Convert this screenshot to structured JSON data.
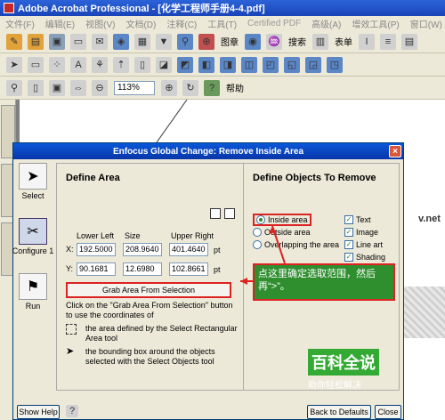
{
  "app": {
    "title": "Adobe Acrobat Professional - [化学工程师手册4-4.pdf]",
    "menu": [
      "文件(F)",
      "编辑(E)",
      "视图(V)",
      "文档(D)",
      "注释(C)",
      "工具(T)",
      "Certified PDF",
      "高级(A)",
      "增效工具(P)",
      "窗口(W)"
    ],
    "toolbar": {
      "stamp": "图章",
      "search": "搜索",
      "form": "表单",
      "help": "帮助",
      "zoom": "113%"
    }
  },
  "page_fragment": "v.net",
  "dialog": {
    "title": "Enfocus Global Change: Remove Inside Area",
    "side": {
      "select": "Select",
      "configure": "Configure 1",
      "run": "Run"
    },
    "define_area": {
      "heading": "Define Area",
      "col_lower_left": "Lower Left",
      "col_size": "Size",
      "col_upper_right": "Upper Right",
      "x_label": "X:",
      "y_label": "Y:",
      "x_lower_left": "192.5000",
      "x_size": "208.9640",
      "x_upper_right": "401.4640",
      "y_lower_left": "90.1681",
      "y_size": "12.6980",
      "y_upper_right": "102.8661",
      "unit": "pt",
      "grab_button": "Grab Area From Selection",
      "help_text": "Click on the \"Grab Area From Selection\" button to use the coordinates of",
      "option1": "the area defined by the Select Rectangular Area tool",
      "option2": "the bounding box around the objects selected with the Select Objects tool"
    },
    "define_objects": {
      "heading": "Define Objects To Remove",
      "radios": [
        {
          "label": "Inside area",
          "selected": true
        },
        {
          "label": "Outside area",
          "selected": false
        },
        {
          "label": "Overlapping the area",
          "selected": false
        }
      ],
      "checks": [
        {
          "label": "Text",
          "checked": true
        },
        {
          "label": "Image",
          "checked": true
        },
        {
          "label": "Line art",
          "checked": true
        },
        {
          "label": "Shading",
          "checked": true
        }
      ]
    },
    "buttons": {
      "show_help": "Show Help",
      "back_to_defaults": "Back to Defaults",
      "close": "Close"
    }
  },
  "annotation": {
    "callout": "点这里确定选取范围，然后再“>”。"
  },
  "watermark": {
    "main": "百科全说",
    "sub": "助你轻松解决"
  }
}
